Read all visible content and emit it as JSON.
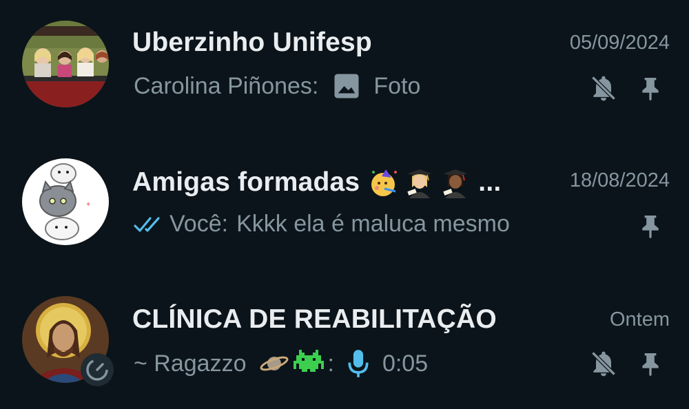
{
  "chats": [
    {
      "name": "Uberzinho Unifesp",
      "date": "05/09/2024",
      "preview_sender": "Carolina Piñones:",
      "preview_text": "Foto",
      "preview_icon": "image-icon",
      "muted": true,
      "pinned": true
    },
    {
      "name": "Amigas formadas",
      "name_emojis": [
        "party-face-icon",
        "graduate-woman-icon",
        "graduate-woman-icon"
      ],
      "name_ellipsis": "...",
      "date": "18/08/2024",
      "preview_sender": "Você:",
      "preview_text": "Kkkk ela é maluca mesmo",
      "preview_icon": "double-check-icon",
      "muted": false,
      "pinned": true
    },
    {
      "name": "CLÍNICA DE REABILITAÇÃO",
      "date": "Ontem",
      "preview_sender": "~ Ragazzo",
      "preview_emojis": [
        "planet-icon",
        "alien-monster-icon"
      ],
      "preview_separator": ":",
      "preview_text": "0:05",
      "preview_icon": "microphone-icon",
      "muted": true,
      "pinned": true
    }
  ],
  "colors": {
    "background": "#0b141a",
    "title": "#e9edef",
    "secondary": "#8696a0",
    "read_check": "#53bdeb",
    "mic": "#53bdeb",
    "icon_gray": "#8696a0"
  }
}
